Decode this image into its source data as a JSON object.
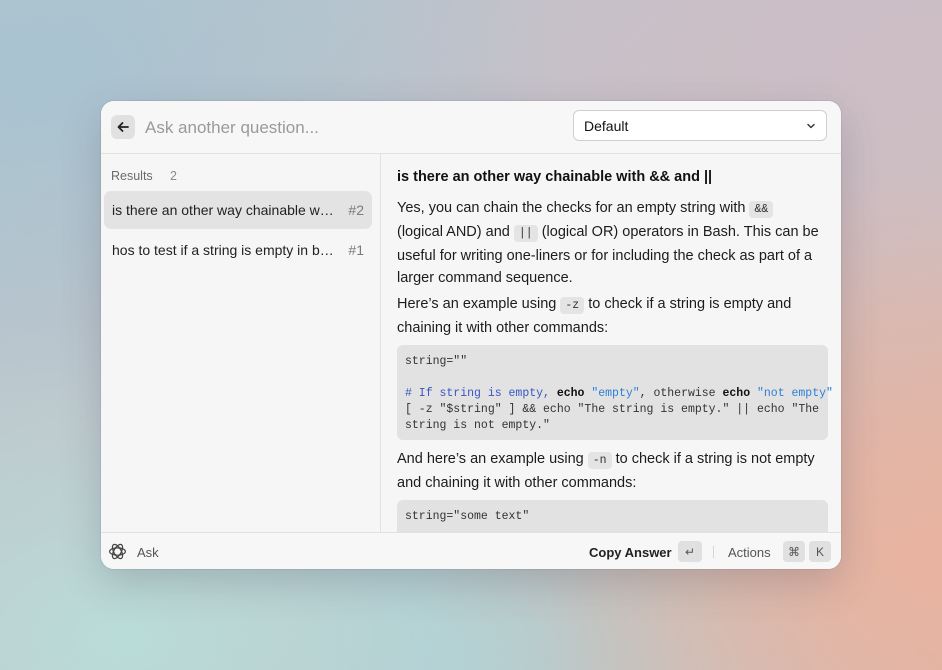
{
  "topbar": {
    "search_placeholder": "Ask another question...",
    "model_select": "Default"
  },
  "results": {
    "label": "Results",
    "count": "2",
    "items": [
      {
        "title": "is there an other way chainable with && and ||",
        "num": "#2"
      },
      {
        "title": "hos to test if a string is empty in bash",
        "num": "#1"
      }
    ]
  },
  "answer": {
    "question": "is there an other way chainable with && and ||",
    "p1_a": "Yes, you can chain the checks for an empty string with",
    "p1_code1": "&&",
    "p1_b": "(logical AND) and",
    "p1_code2": "||",
    "p1_c": "(logical OR) operators in Bash. This can be useful for writing one-liners or for including the check as part of a larger command sequence.",
    "p2_a": "Here’s an example using",
    "p2_code": "-z",
    "p2_b": "to check if a string is empty and chaining it with other commands:",
    "code1": {
      "line1": "string=\"\"",
      "c_hash": "# If string is empty, ",
      "c_echo1": "echo",
      "c_str1": "\"empty\"",
      "c_mid": ", otherwise ",
      "c_echo2": "echo",
      "c_str2": "\"not empty\"",
      "line3": "[ -z \"$string\" ] && echo \"The string is empty.\" || echo \"The",
      "line4": "string is not empty.\""
    },
    "p3_a": "And here’s an example using",
    "p3_code": "-n",
    "p3_b": "to check if a string is not empty and chaining it with other commands:",
    "code2": {
      "line1": "string=\"some text\""
    }
  },
  "bottombar": {
    "ask_label": "Ask",
    "copy_label": "Copy Answer",
    "enter_key": "↵",
    "actions_label": "Actions",
    "cmd_key": "⌘",
    "k_key": "K"
  }
}
